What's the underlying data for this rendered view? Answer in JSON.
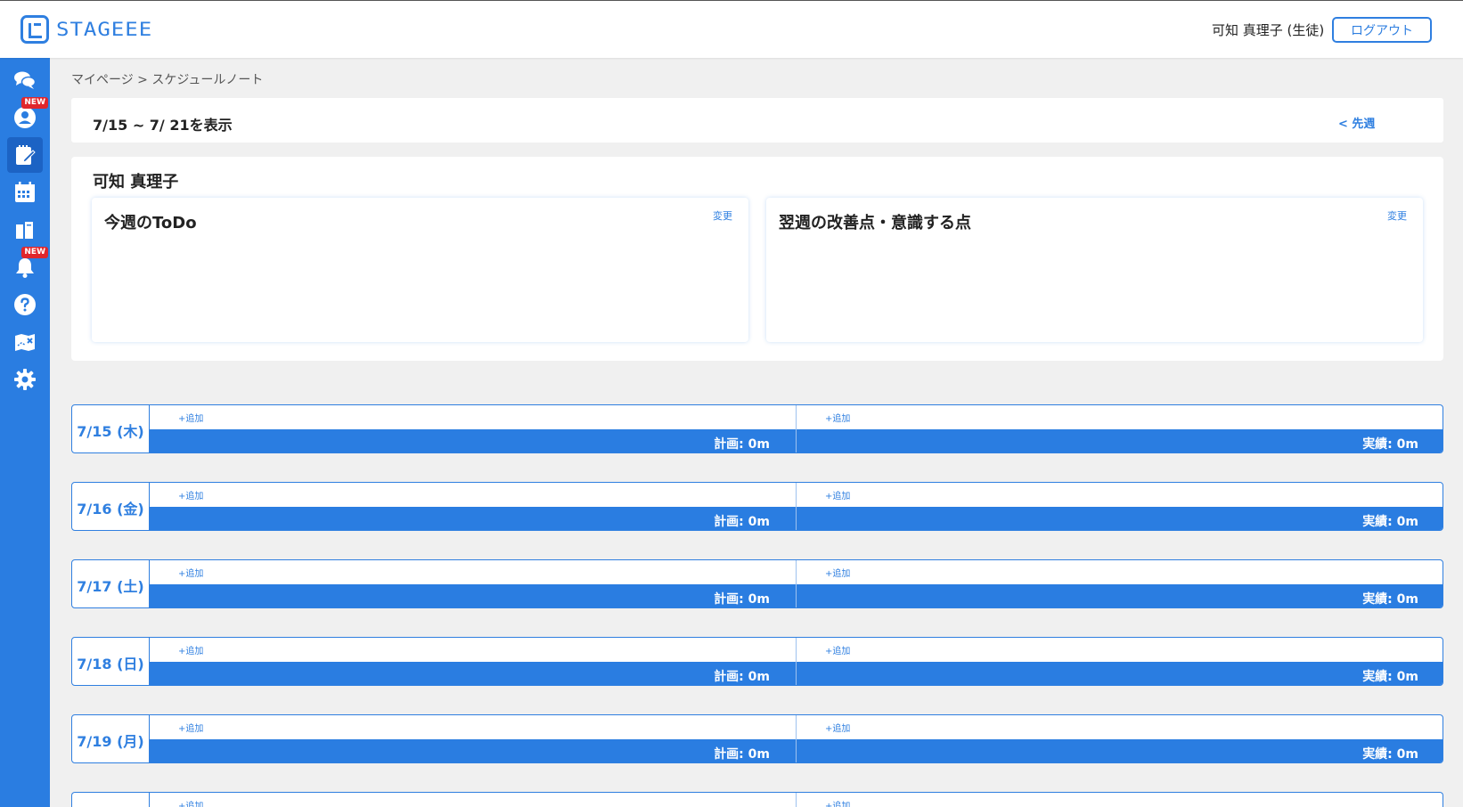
{
  "header": {
    "logo_text": "STAGEEE",
    "user_name": "可知 真理子 (生徒)",
    "logout_label": "ログアウト"
  },
  "sidebar": {
    "items": [
      {
        "icon": "chat-icon",
        "badge": ""
      },
      {
        "icon": "profile-icon",
        "badge": "NEW"
      },
      {
        "icon": "schedule-note-icon",
        "badge": "",
        "active": true
      },
      {
        "icon": "calendar-icon",
        "badge": ""
      },
      {
        "icon": "book-icon",
        "badge": ""
      },
      {
        "icon": "bell-icon",
        "badge": "NEW"
      },
      {
        "icon": "help-icon",
        "badge": ""
      },
      {
        "icon": "map-icon",
        "badge": ""
      },
      {
        "icon": "gear-icon",
        "badge": ""
      }
    ]
  },
  "breadcrumb": "マイページ > スケジュールノート",
  "week": {
    "title": "7/15 ~ 7/ 21を表示",
    "prev_label": "< 先週"
  },
  "student": {
    "name": "可知 真理子",
    "todo_title": "今週のToDo",
    "improve_title": "翌週の改善点・意識する点",
    "change_label": "変更"
  },
  "days": [
    {
      "date": "7/15 (木)",
      "plan": "計画: 0m",
      "actual": "実績: 0m",
      "add": "+追加"
    },
    {
      "date": "7/16 (金)",
      "plan": "計画: 0m",
      "actual": "実績: 0m",
      "add": "+追加"
    },
    {
      "date": "7/17 (土)",
      "plan": "計画: 0m",
      "actual": "実績: 0m",
      "add": "+追加"
    },
    {
      "date": "7/18 (日)",
      "plan": "計画: 0m",
      "actual": "実績: 0m",
      "add": "+追加"
    },
    {
      "date": "7/19 (月)",
      "plan": "計画: 0m",
      "actual": "実績: 0m",
      "add": "+追加"
    },
    {
      "date": "",
      "plan": "",
      "actual": "",
      "add": "+追加"
    }
  ],
  "colors": {
    "accent": "#2a7de1",
    "badge": "#e0262c"
  }
}
